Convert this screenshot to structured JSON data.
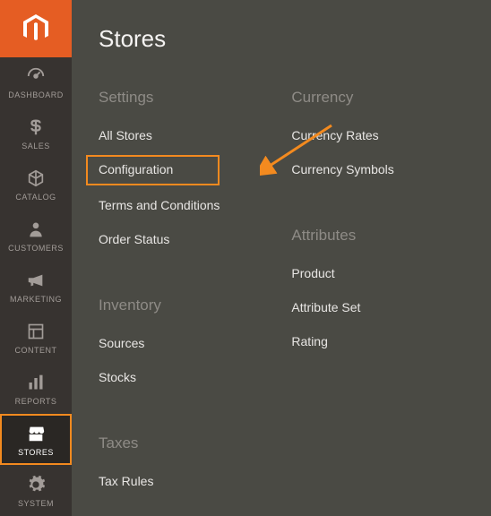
{
  "page_title": "Stores",
  "nav": {
    "dashboard": "DASHBOARD",
    "sales": "SALES",
    "catalog": "CATALOG",
    "customers": "CUSTOMERS",
    "marketing": "MARKETING",
    "content": "CONTENT",
    "reports": "REPORTS",
    "stores": "STORES",
    "system": "SYSTEM"
  },
  "left_column": {
    "settings_heading": "Settings",
    "all_stores": "All Stores",
    "configuration": "Configuration",
    "terms": "Terms and Conditions",
    "order_status": "Order Status",
    "inventory_heading": "Inventory",
    "sources": "Sources",
    "stocks": "Stocks",
    "taxes_heading": "Taxes",
    "tax_rules": "Tax Rules"
  },
  "right_column": {
    "currency_heading": "Currency",
    "currency_rates": "Currency Rates",
    "currency_symbols": "Currency Symbols",
    "attributes_heading": "Attributes",
    "product": "Product",
    "attribute_set": "Attribute Set",
    "rating": "Rating"
  }
}
